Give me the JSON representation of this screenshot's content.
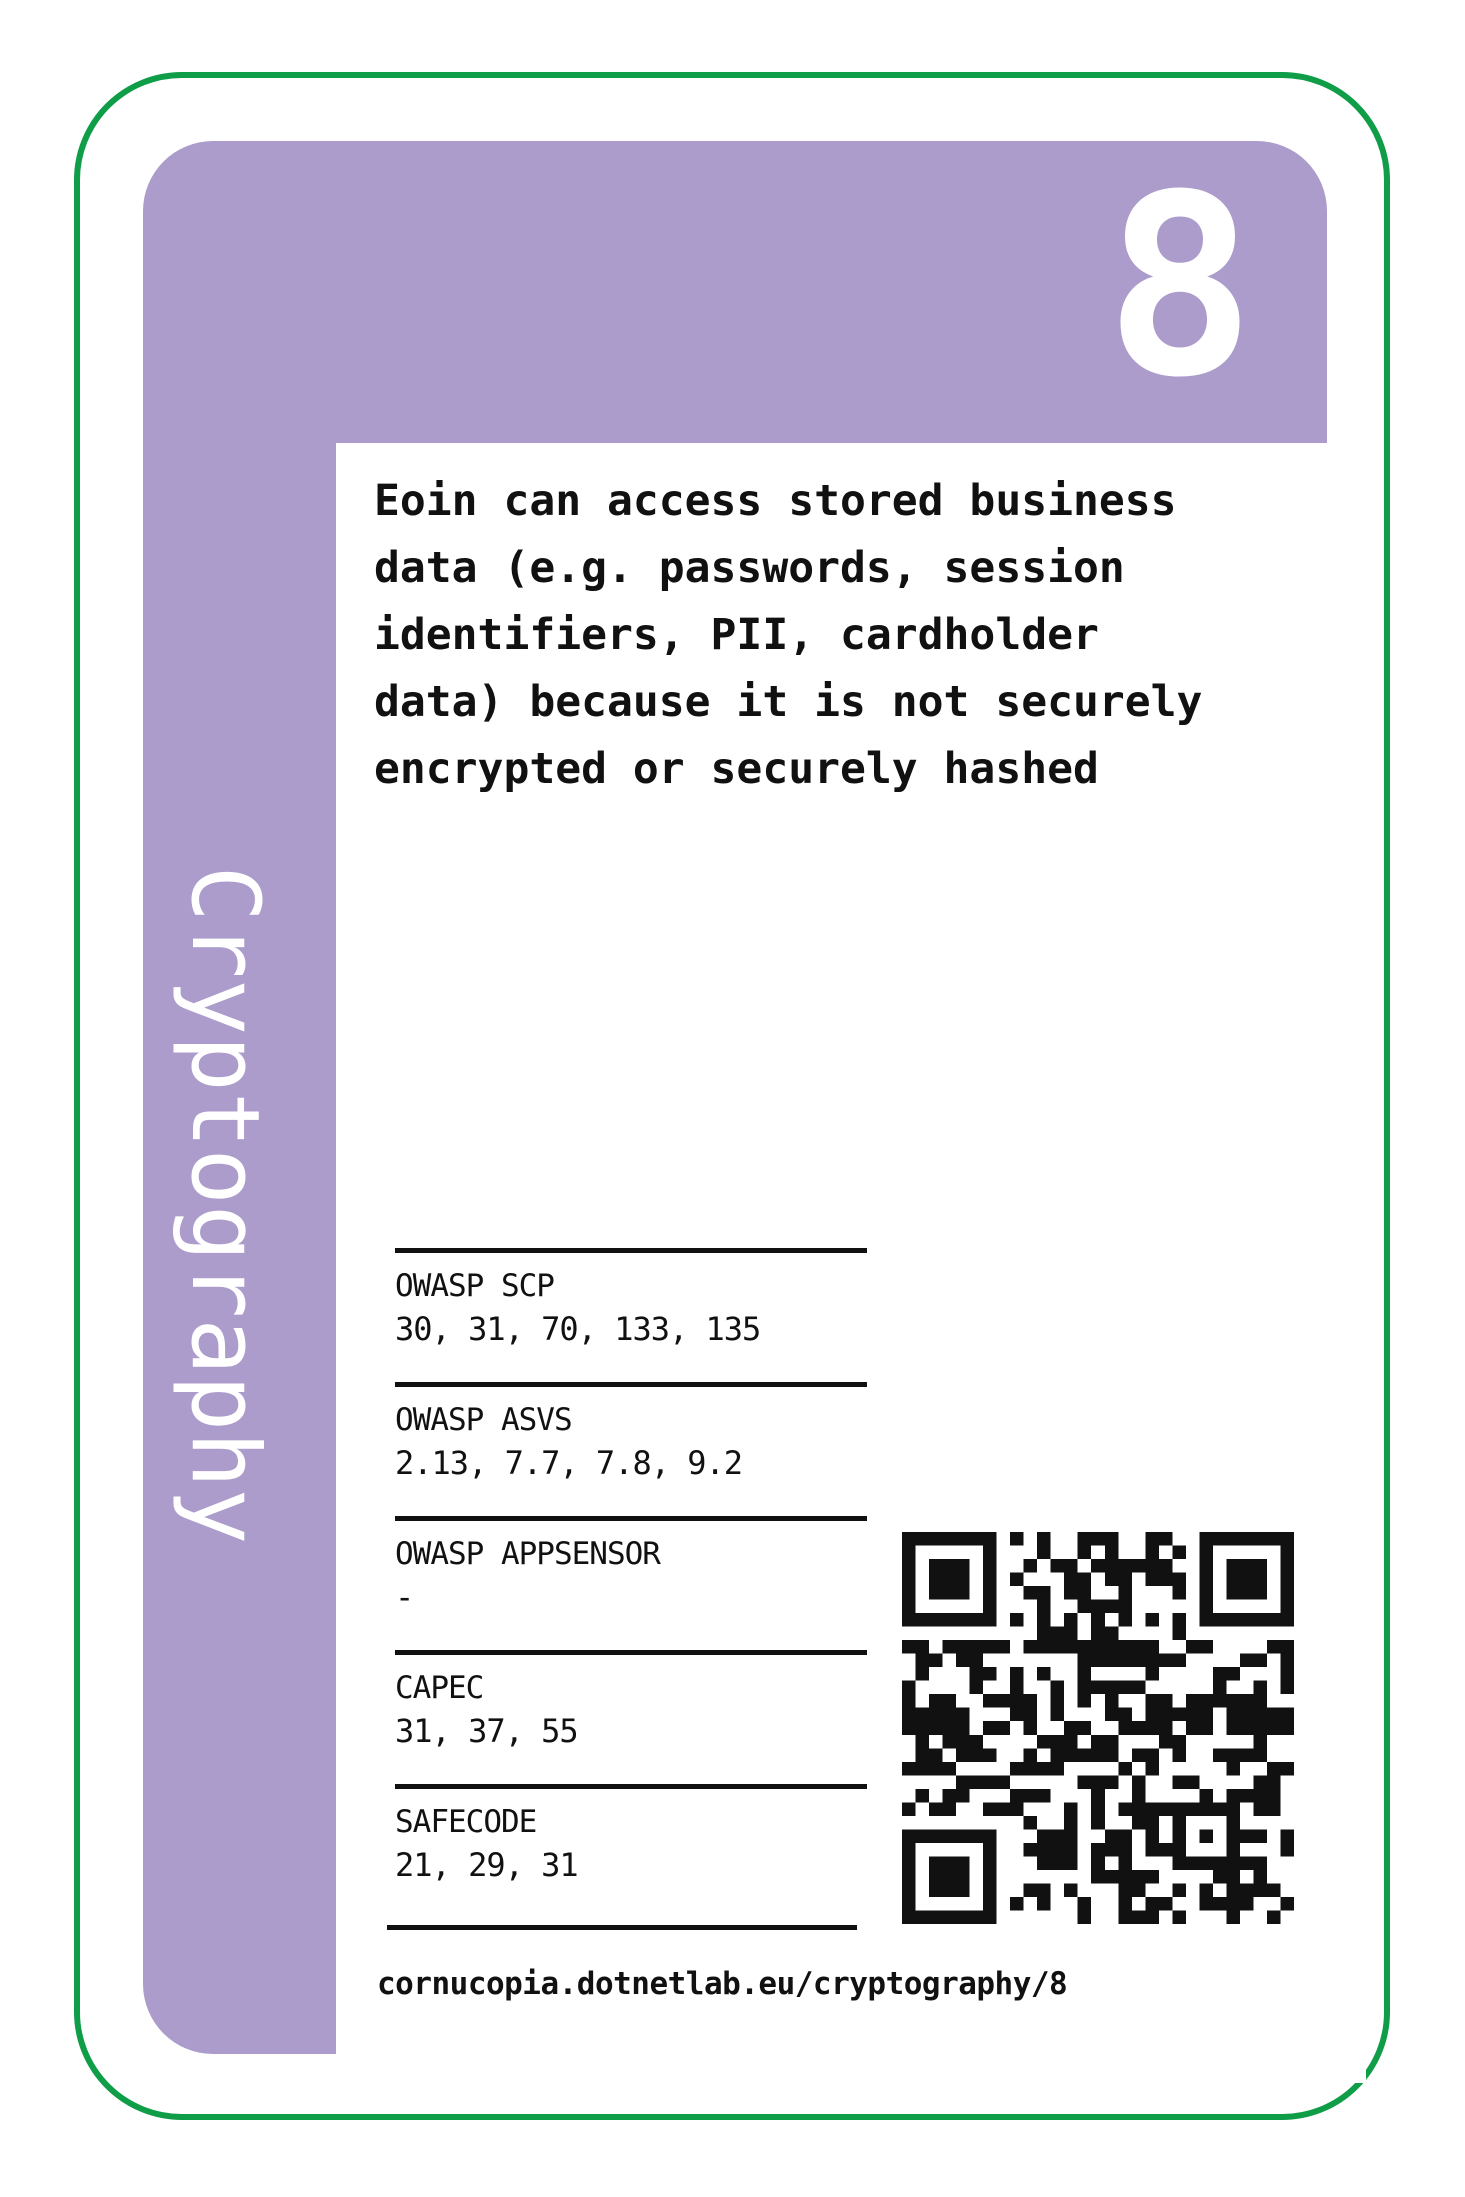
{
  "card": {
    "number": "8",
    "suit": "Cryptography",
    "description": "Eoin can access stored business\ndata (e.g. passwords, session\nidentifiers, PII, cardholder\ndata) because it is not securely\nencrypted or securely hashed",
    "references": [
      {
        "title": "OWASP SCP",
        "values": "30, 31, 70, 133, 135"
      },
      {
        "title": "OWASP ASVS",
        "values": "2.13, 7.7, 7.8, 9.2"
      },
      {
        "title": "OWASP APPSENSOR",
        "values": "-"
      },
      {
        "title": "CAPEC",
        "values": "31, 37, 55"
      },
      {
        "title": "SAFECODE",
        "values": "21, 29, 31"
      }
    ],
    "url": "cornucopia.dotnetlab.eu/cryptography/8"
  },
  "colors": {
    "border": "#0f9d48",
    "suit": "#ab9ccb",
    "ink": "#111111"
  },
  "icons": {
    "qr": "qr-code-icon"
  }
}
